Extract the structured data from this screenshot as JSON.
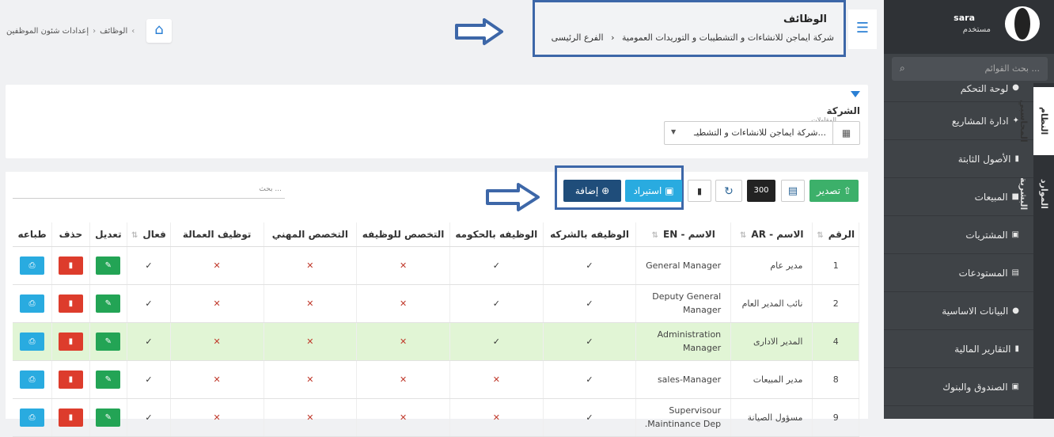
{
  "user": {
    "name": "sara",
    "role": "مستخدم"
  },
  "menu_search": {
    "placeholder": "بحث القوائم ..."
  },
  "vtabs": [
    "النظام المحاسبي",
    "الموارد البشرية"
  ],
  "menu": [
    {
      "label": "لوحة التحكم",
      "icon": "info-icon"
    },
    {
      "label": "ادارة المشاريع",
      "icon": "handshake-icon"
    },
    {
      "label": "الأصول الثابتة",
      "icon": "file-icon"
    },
    {
      "label": "المبيعات",
      "icon": "truck-icon"
    },
    {
      "label": "المشتريات",
      "icon": "money-icon"
    },
    {
      "label": "المستودعات",
      "icon": "archive-icon"
    },
    {
      "label": "البيانات الاساسية",
      "icon": "info-icon"
    },
    {
      "label": "التقارير المالية",
      "icon": "file-icon"
    },
    {
      "label": "الصندوق والبنوك",
      "icon": "money-icon"
    }
  ],
  "breadcrumb": [
    "الوظائف",
    "إعدادات شئون الموظفين"
  ],
  "page": {
    "title": "الوظائف",
    "branch": "الفرع الرئيسى",
    "company": "شركة ايماجن للانشاءات و التشطيبات و التوريدات العمومية"
  },
  "filter": {
    "label": "الشركة",
    "small_label": "المقاولات",
    "company_value": "شركة ايماجن للانشاءات و التشطيـ..."
  },
  "toolbar": {
    "export": "تصدير",
    "page_size": "300",
    "import": "استيراد",
    "add": "إضافة",
    "search_placeholder": "بحث ..."
  },
  "table": {
    "headers": [
      "الرقم",
      "الاسم - AR",
      "الاسم - EN",
      "الوظيفه بالشركه",
      "الوظيفه بالحكومه",
      "التخصص للوظيفه",
      "التخصص المهني",
      "توظيف العمالة",
      "فعال",
      "تعديل",
      "حذف",
      "طباعه"
    ],
    "rows": [
      {
        "num": "1",
        "ar": "مدير عام",
        "en": "General Manager",
        "c1": "✓",
        "c2": "✓",
        "c3": "✕",
        "c4": "✕",
        "c5": "✕",
        "active": "✓",
        "hl": false
      },
      {
        "num": "2",
        "ar": "نائب المدير العام",
        "en": "Deputy General Manager",
        "c1": "✓",
        "c2": "✓",
        "c3": "✕",
        "c4": "✕",
        "c5": "✕",
        "active": "✓",
        "hl": false
      },
      {
        "num": "4",
        "ar": "المدير الادارى",
        "en": "Administration Manager",
        "c1": "✓",
        "c2": "✓",
        "c3": "✕",
        "c4": "✕",
        "c5": "✕",
        "active": "✓",
        "hl": true
      },
      {
        "num": "8",
        "ar": "مدير المبيعات",
        "en": "sales-Manager",
        "c1": "✓",
        "c2": "✕",
        "c3": "✕",
        "c4": "✕",
        "c5": "✕",
        "active": "✓",
        "hl": false
      },
      {
        "num": "9",
        "ar": "مسؤول الصيانة",
        "en": "Supervisour Maintinance Dep.",
        "c1": "✓",
        "c2": "✕",
        "c3": "✕",
        "c4": "✕",
        "c5": "✕",
        "active": "✓",
        "hl": false
      }
    ]
  }
}
